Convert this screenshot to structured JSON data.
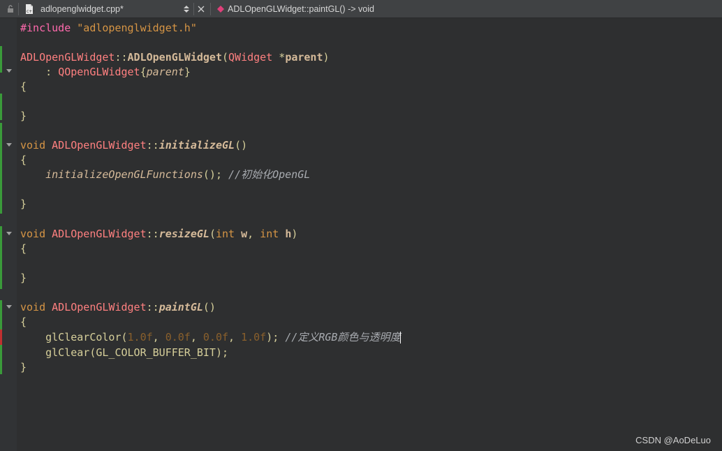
{
  "toolbar": {
    "file_name": "adlopenglwidget.cpp*",
    "symbol": "ADLOpenGLWidget::paintGL() -> void",
    "lock_icon": "lock-icon",
    "file_icon": "cpp-file-icon",
    "close_icon": "close-icon",
    "symbol_icon": "method-icon"
  },
  "code": {
    "include_directive": "#include",
    "include_file": "\"adlopenglwidget.h\"",
    "class_name": "ADLOpenGLWidget",
    "scope": "::",
    "ctor_name": "ADLOpenGLWidget",
    "open_paren": "(",
    "close_paren": ")",
    "qwidget_type": "QWidget",
    "ptr": " *",
    "parent_param": "parent",
    "init_colon": "    : ",
    "base_class": "QOpenGLWidget",
    "init_open": "{",
    "parent_arg": "parent",
    "init_close": "}",
    "brace_open": "{",
    "brace_close": "}",
    "void_kw": "void",
    "space": " ",
    "initializeGL": "initializeGL",
    "empty_params": "()",
    "indent": "    ",
    "init_functions_call": "initializeOpenGLFunctions",
    "call_end": "(); ",
    "comment_init": "//初始化OpenGL",
    "resizeGL": "resizeGL",
    "int_kw": "int",
    "param_w": "w",
    "comma": ", ",
    "param_h": "h",
    "paintGL": "paintGL",
    "clear_color_fn": "glClearColor",
    "num_1": "1.0f",
    "num_0a": "0.0f",
    "num_0b": "0.0f",
    "num_1b": "1.0f",
    "call_close": "); ",
    "comment_color": "//定义RGB颜色与透明度",
    "clear_line": "glClear(GL_COLOR_BUFFER_BIT);"
  },
  "watermark": "CSDN @AoDeLuo",
  "colors": {
    "keyword": "#d69545",
    "type": "#ff8080",
    "preprocessor": "#ff6aad",
    "number": "#8a602c",
    "comment": "#a8abb0",
    "changed_bar_green": "#3a9a3a",
    "changed_bar_red": "#c03030"
  }
}
